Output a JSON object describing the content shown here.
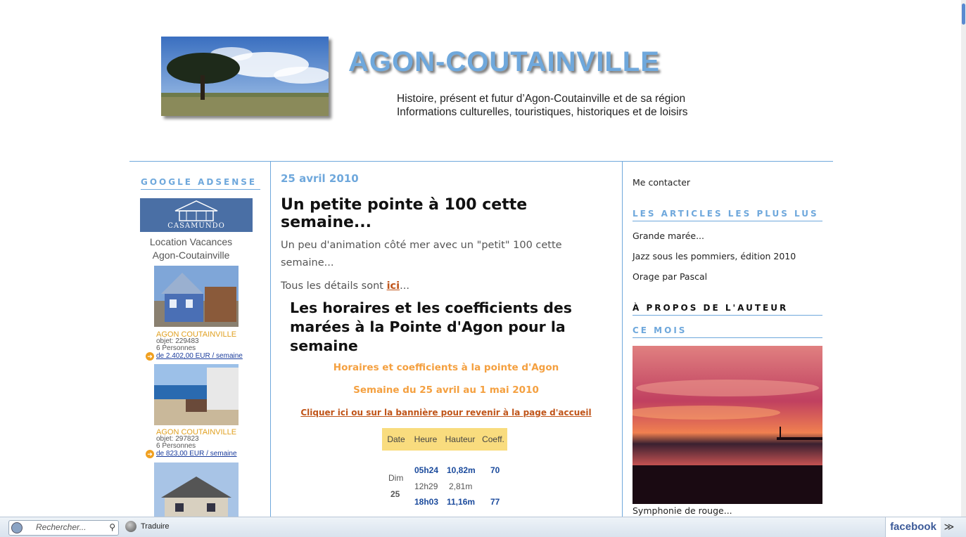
{
  "header": {
    "title": "AGON-COUTAINVILLE",
    "subtitle_line1": "Histoire, présent et futur d’Agon-Coutainville et de sa région",
    "subtitle_line2": "Informations culturelles, touristiques, historiques et de loisirs"
  },
  "left": {
    "section_title": "GOOGLE ADSENSE",
    "brand": "CASAMUNDO",
    "loc_line1": "Location Vacances",
    "loc_line2": "Agon-Coutainville",
    "ads": [
      {
        "city": "AGON COUTAINVILLE",
        "objet": "objet: 229483",
        "persons": "6 Personnes",
        "price": "de 2.402,00 EUR / semaine"
      },
      {
        "city": "AGON COUTAINVILLE",
        "objet": "objet: 297823",
        "persons": "6 Personnes",
        "price": "de 823,00 EUR / semaine"
      }
    ]
  },
  "post": {
    "date": "25 avril 2010",
    "title": "Un petite pointe à 100 cette semaine...",
    "body": "Un peu d'animation côté mer avec un \"petit\" 100 cette semaine...",
    "details_prefix": "Tous les détails sont ",
    "details_link": "ici",
    "details_suffix": "...",
    "tide_heading": "Les horaires et les coefficients des marées à la Pointe d'Agon pour la semaine",
    "tide_sub1": "Horaires et coefficients à la pointe d'Agon",
    "tide_sub2": "Semaine du 25 avril au 1 mai 2010",
    "tide_link": "Cliquer ici ou sur la bannière pour revenir à la page d'accueil",
    "table": {
      "headers": [
        "Date",
        "Heure",
        "Hauteur",
        "Coeff."
      ],
      "day_name": "Dim",
      "day_num": "25",
      "rows": [
        {
          "heure": "05h24",
          "hauteur": "10,82m",
          "coeff": "70"
        },
        {
          "heure": "12h29",
          "hauteur": "2,81m",
          "coeff": ""
        },
        {
          "heure": "18h03",
          "hauteur": "11,16m",
          "coeff": "77"
        }
      ]
    }
  },
  "right": {
    "contact": "Me contacter",
    "most_read_title": "LES ARTICLES LES PLUS LUS",
    "most_read": [
      "Grande marée...",
      "Jazz sous les pommiers, édition 2010",
      "Orage par Pascal"
    ],
    "about_title": "À PROPOS DE L'AUTEUR",
    "month_title": "CE MOIS",
    "photo_caption": "Symphonie de rouge..."
  },
  "toolbar": {
    "search_placeholder": "Rechercher...",
    "translate": "Traduire",
    "facebook": "facebook",
    "chevron": "≫"
  }
}
